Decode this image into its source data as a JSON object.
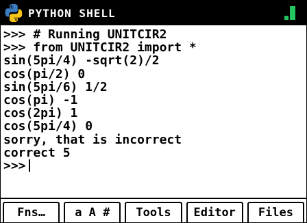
{
  "titlebar": {
    "title": "PYTHON SHELL"
  },
  "console": {
    "lines": [
      ">>> # Running UNITCIR2",
      ">>> from UNITCIR2 import *",
      "sin(5pi/4) -sqrt(2)/2",
      "cos(pi/2) 0",
      "sin(5pi/6) 1/2",
      "cos(pi) -1",
      "cos(2pi) 1",
      "cos(5pi/4) 0",
      "sorry, that is incorrect",
      "correct 5",
      ">>>"
    ]
  },
  "softkeys": {
    "fns": "Fns…",
    "chars": "a A #",
    "tools": "Tools",
    "editor": "Editor",
    "files": "Files"
  },
  "colors": {
    "titlebar_bg": "#000000",
    "battery": "#22c55e"
  }
}
